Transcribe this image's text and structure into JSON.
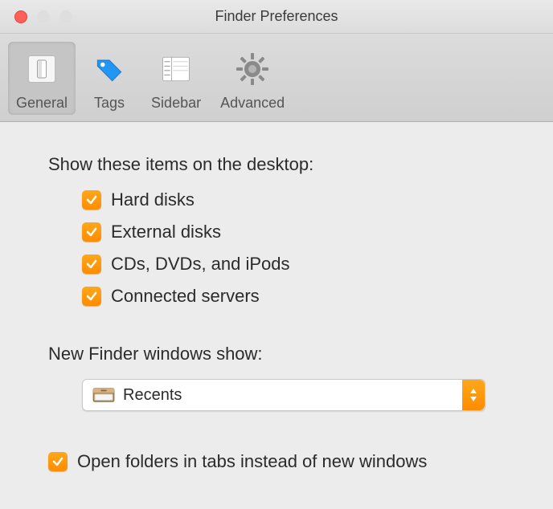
{
  "window": {
    "title": "Finder Preferences"
  },
  "toolbar": {
    "tabs": [
      {
        "label": "General",
        "active": true
      },
      {
        "label": "Tags",
        "active": false
      },
      {
        "label": "Sidebar",
        "active": false
      },
      {
        "label": "Advanced",
        "active": false
      }
    ]
  },
  "desktop_items": {
    "heading": "Show these items on the desktop:",
    "options": [
      {
        "label": "Hard disks",
        "checked": true
      },
      {
        "label": "External disks",
        "checked": true
      },
      {
        "label": "CDs, DVDs, and iPods",
        "checked": true
      },
      {
        "label": "Connected servers",
        "checked": true
      }
    ]
  },
  "new_windows": {
    "heading": "New Finder windows show:",
    "selected": "Recents"
  },
  "open_in_tabs": {
    "label": "Open folders in tabs instead of new windows",
    "checked": true
  }
}
